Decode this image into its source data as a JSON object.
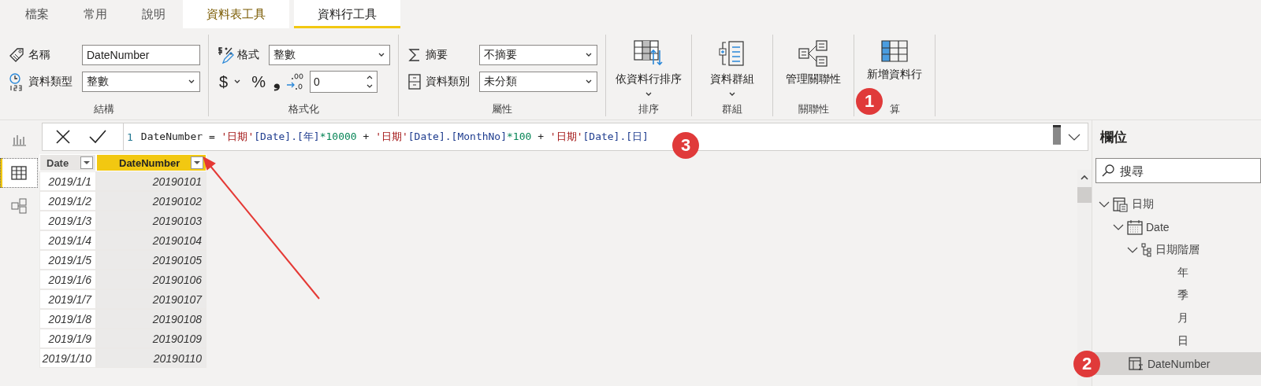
{
  "tabs": [
    {
      "label": "檔案",
      "kind": "plain",
      "selected": false
    },
    {
      "label": "常用",
      "kind": "plain",
      "selected": false
    },
    {
      "label": "說明",
      "kind": "plain",
      "selected": false
    },
    {
      "label": "資料表工具",
      "kind": "contextual",
      "selected": false
    },
    {
      "label": "資料行工具",
      "kind": "contextual",
      "selected": true
    }
  ],
  "ribbon": {
    "groups": [
      {
        "kind": "fields",
        "label": "結構",
        "rows": [
          {
            "kind": "input",
            "label": "名稱",
            "value": "DateNumber"
          },
          {
            "kind": "select",
            "label": "資料類型",
            "value": "整數"
          }
        ]
      },
      {
        "kind": "fields",
        "label": "格式化",
        "rows": [
          {
            "kind": "select",
            "label": "格式",
            "value": "整數"
          },
          {
            "kind": "format",
            "currency": "$",
            "percent": "%",
            "comma": "❟",
            "value": "0"
          }
        ]
      },
      {
        "kind": "fields",
        "label": "屬性",
        "rows": [
          {
            "kind": "select",
            "label": "摘要",
            "value": "不摘要"
          },
          {
            "kind": "select",
            "label": "資料類別",
            "value": "未分類"
          }
        ]
      },
      {
        "kind": "large",
        "label": "排序",
        "button": "依資料行排序",
        "dropdown": true
      },
      {
        "kind": "large",
        "label": "群組",
        "button": "資料群組",
        "dropdown": true
      },
      {
        "kind": "large",
        "label": "關聯性",
        "button": "管理關聯性",
        "dropdown": false
      },
      {
        "kind": "large",
        "label": "算",
        "button": "新增資料行",
        "dropdown": false
      }
    ]
  },
  "views": [
    {
      "selected": false
    },
    {
      "selected": true
    },
    {
      "selected": false
    }
  ],
  "formula": {
    "line": "1",
    "tokens": [
      {
        "kind": "plain",
        "text": "DateNumber = "
      },
      {
        "kind": "string",
        "text": "'日期'"
      },
      {
        "kind": "column",
        "text": "[Date].[年]"
      },
      {
        "kind": "number",
        "text": "*10000"
      },
      {
        "kind": "plain",
        "text": " + "
      },
      {
        "kind": "string",
        "text": "'日期'"
      },
      {
        "kind": "column",
        "text": "[Date].[MonthNo]"
      },
      {
        "kind": "number",
        "text": "*100"
      },
      {
        "kind": "plain",
        "text": " + "
      },
      {
        "kind": "string",
        "text": "'日期'"
      },
      {
        "kind": "column",
        "text": "[Date].[日]"
      }
    ]
  },
  "table": {
    "columns": [
      {
        "label": "Date",
        "selected": false
      },
      {
        "label": "DateNumber",
        "selected": true
      }
    ],
    "rows": [
      [
        "2019/1/1",
        "20190101"
      ],
      [
        "2019/1/2",
        "20190102"
      ],
      [
        "2019/1/3",
        "20190103"
      ],
      [
        "2019/1/4",
        "20190104"
      ],
      [
        "2019/1/5",
        "20190105"
      ],
      [
        "2019/1/6",
        "20190106"
      ],
      [
        "2019/1/7",
        "20190107"
      ],
      [
        "2019/1/8",
        "20190108"
      ],
      [
        "2019/1/9",
        "20190109"
      ],
      [
        "2019/1/10",
        "20190110"
      ]
    ]
  },
  "fields": {
    "title": "欄位",
    "search": {
      "placeholder": "搜尋"
    },
    "tree": [
      {
        "label": "日期",
        "kind": "table",
        "expanded": true,
        "children": [
          {
            "label": "Date",
            "kind": "date",
            "expanded": true,
            "selected": false,
            "children": [
              {
                "label": "日期階層",
                "kind": "hierarchy",
                "expanded": true,
                "children": [
                  {
                    "label": "年",
                    "kind": "level"
                  },
                  {
                    "label": "季",
                    "kind": "level"
                  },
                  {
                    "label": "月",
                    "kind": "level"
                  },
                  {
                    "label": "日",
                    "kind": "level"
                  }
                ]
              }
            ]
          },
          {
            "label": "DateNumber",
            "kind": "calc",
            "selected": true
          }
        ]
      }
    ]
  },
  "badges": [
    "1",
    "2",
    "3"
  ]
}
